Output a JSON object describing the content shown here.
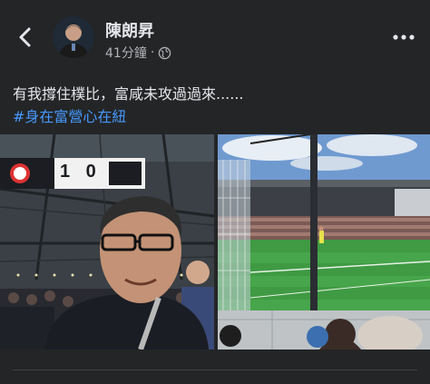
{
  "post": {
    "author_name": "陳朗昇",
    "time_ago": "41分鐘",
    "separator": "·",
    "privacy_icon": "globe-icon",
    "text": "有我撐住樸比，富咸未攻過過來......",
    "hashtag": "#身在富營心在紐"
  },
  "photos": {
    "left": {
      "scoreboard_score": "1  0"
    }
  },
  "colors": {
    "background": "#242526",
    "text_primary": "#e4e6eb",
    "text_secondary": "#b0b3b8",
    "hashtag": "#4599ff"
  }
}
